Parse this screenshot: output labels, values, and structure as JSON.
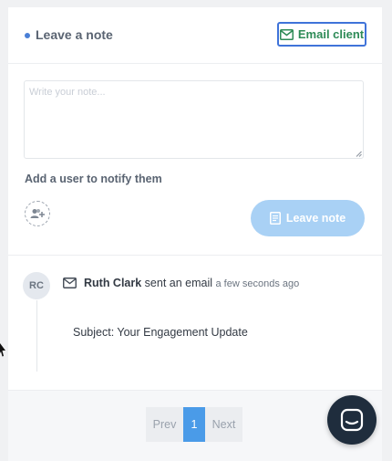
{
  "header": {
    "title": "Leave a note",
    "email_button_label": "Email client"
  },
  "note": {
    "placeholder": "Write your note...",
    "value": ""
  },
  "notify": {
    "label": "Add a user to notify them",
    "add_user_icon": "user-plus-icon"
  },
  "leave_button": {
    "label": "Leave note",
    "icon": "note-icon"
  },
  "activity": {
    "avatar_initials": "RC",
    "icon": "envelope-icon",
    "user": "Ruth Clark",
    "action": " sent an email ",
    "time": "a few seconds ago",
    "subject": "Subject: Your Engagement Update"
  },
  "pagination": {
    "prev_label": "Prev",
    "current_page": "1",
    "next_label": "Next"
  },
  "chat": {
    "icon": "chat-icon"
  },
  "colors": {
    "accent_blue": "#3f73d9",
    "email_text_green": "#2e8b57",
    "leave_button_bg": "#a9d1f5",
    "current_page_bg": "#4a9be8",
    "chat_bg": "#1f2d3d"
  }
}
